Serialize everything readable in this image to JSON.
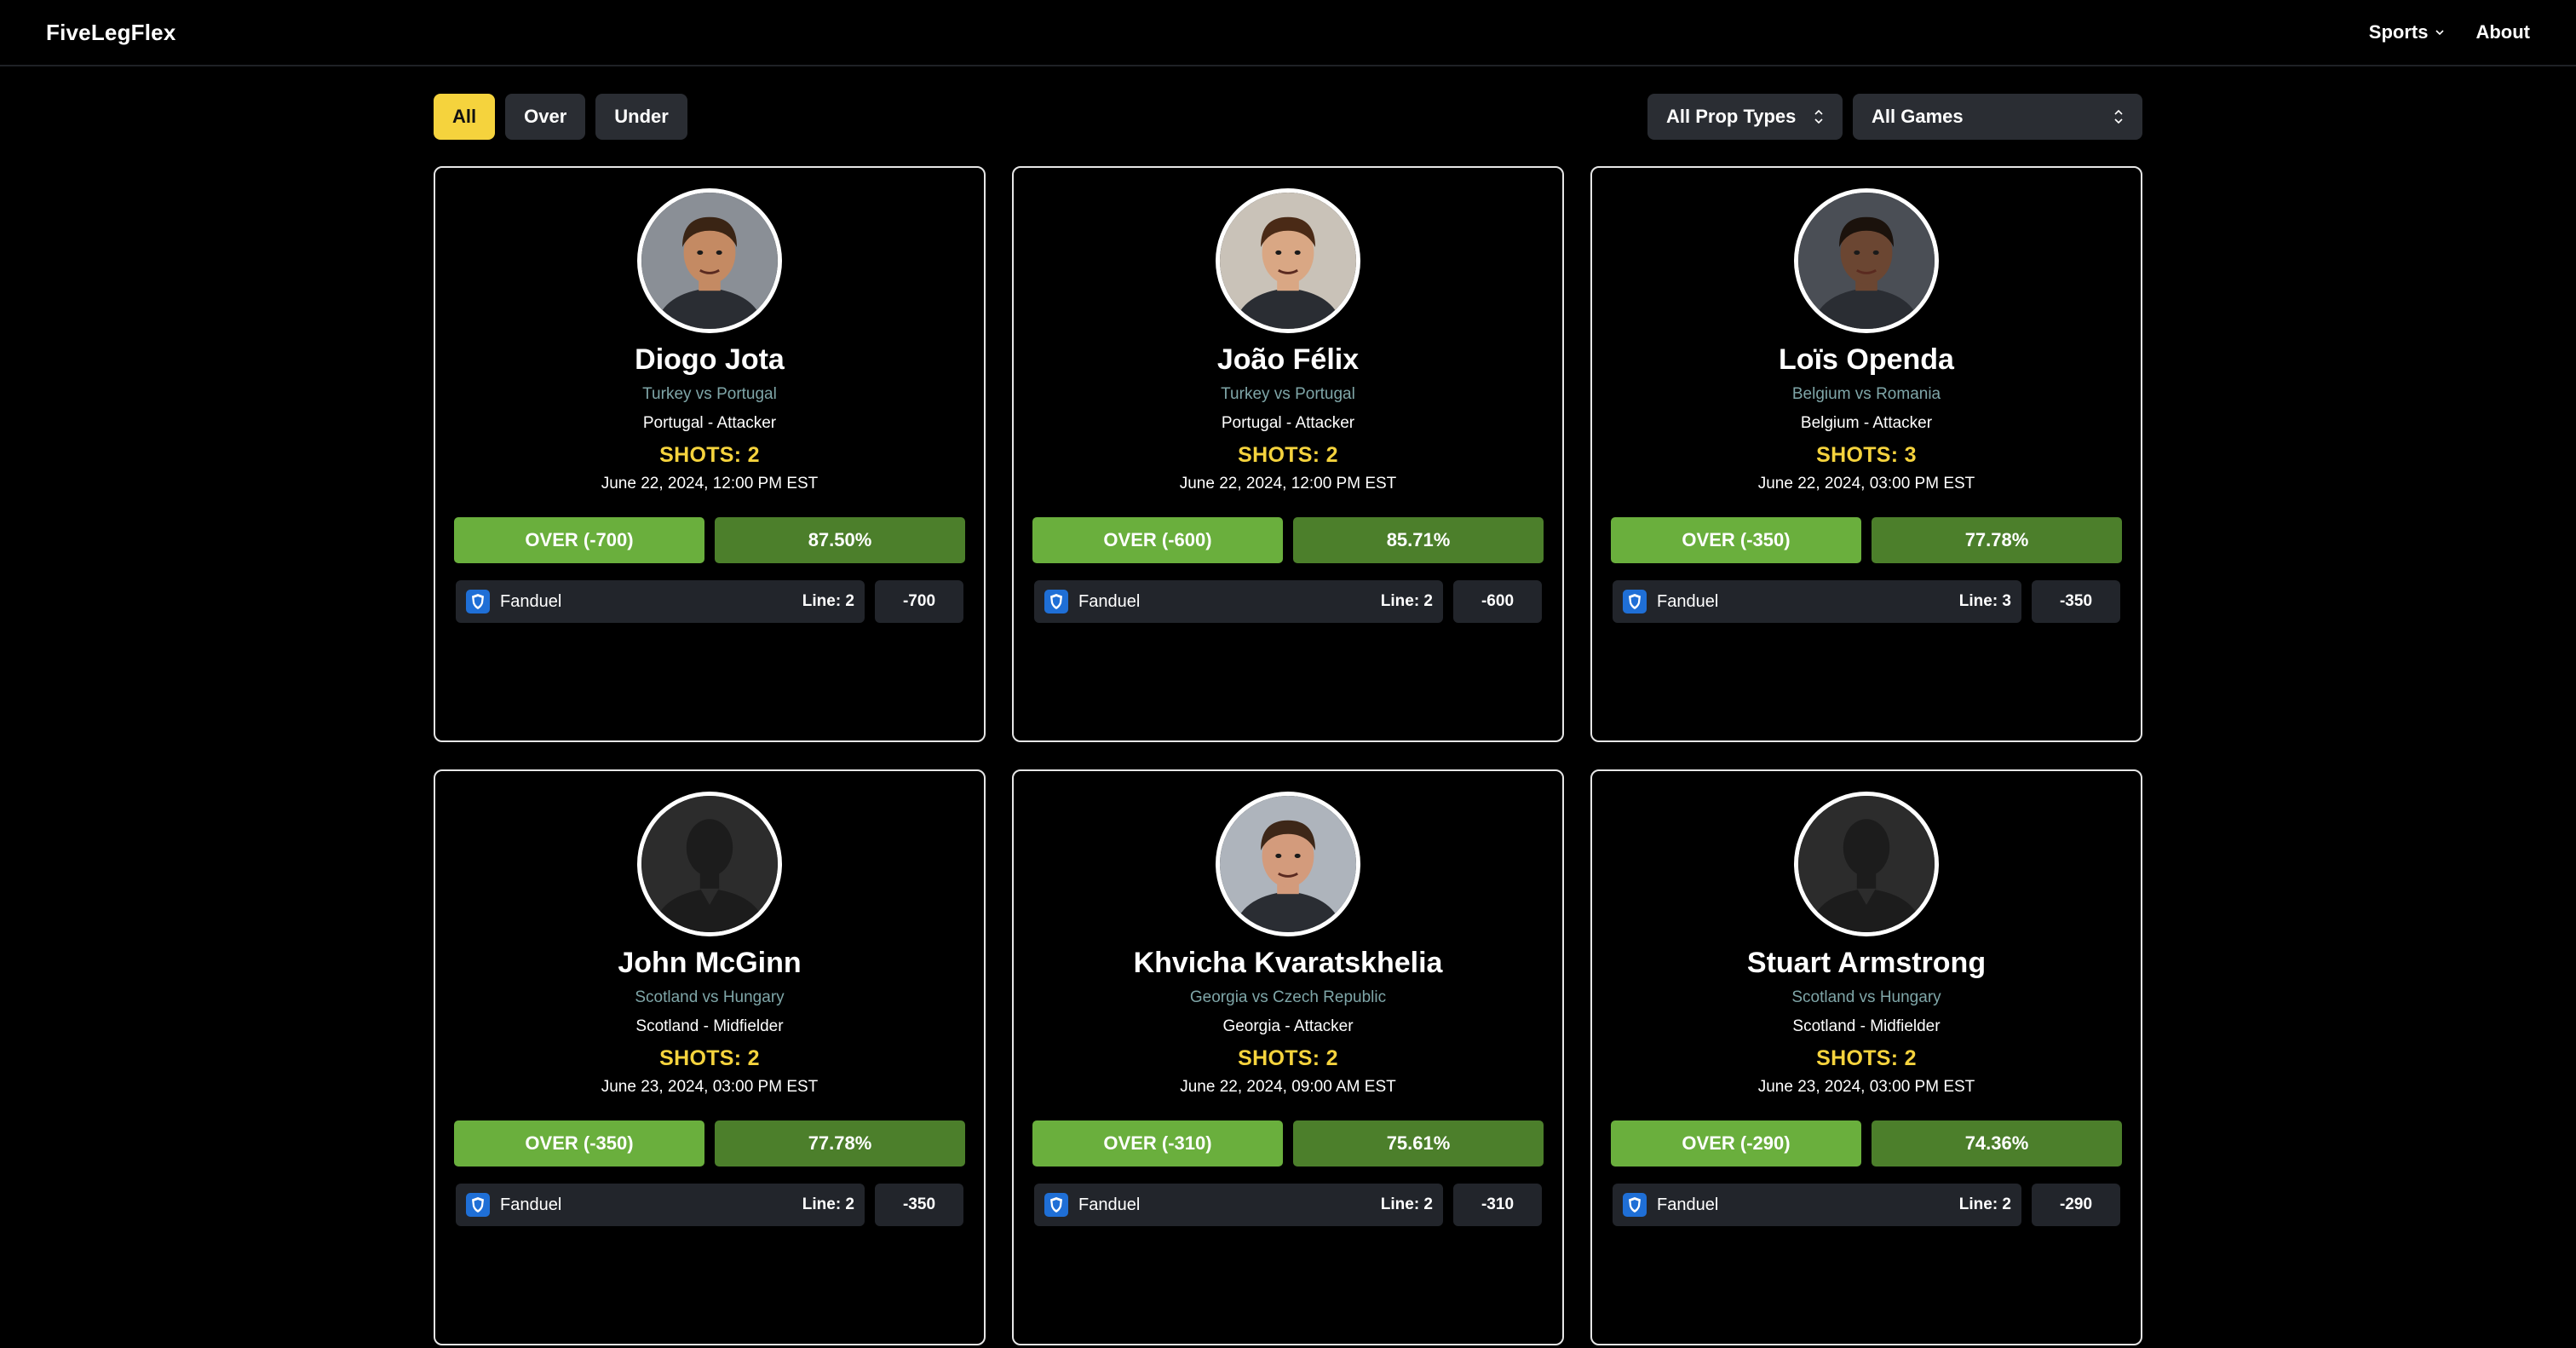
{
  "nav": {
    "brand": "FiveLegFlex",
    "sports_label": "Sports",
    "about_label": "About"
  },
  "filters": {
    "all_label": "All",
    "over_label": "Over",
    "under_label": "Under",
    "active": "All",
    "prop_types": "All Prop Types",
    "games": "All Games"
  },
  "colors": {
    "accent_yellow": "#f5d33d",
    "pick_green": "#6aaf3d",
    "pct_green": "#4c7f2b",
    "matchup_teal": "#7fa6a8"
  },
  "cards": [
    {
      "name": "Diogo Jota",
      "matchup": "Turkey vs Portugal",
      "team_pos": "Portugal - Attacker",
      "prop": "SHOTS: 2",
      "datetime": "June 22, 2024, 12:00 PM EST",
      "pick": "OVER (-700)",
      "pct": "87.50%",
      "book": "Fanduel",
      "line": "Line: 2",
      "odds": "-700",
      "avatar": "photo"
    },
    {
      "name": "João Félix",
      "matchup": "Turkey vs Portugal",
      "team_pos": "Portugal - Attacker",
      "prop": "SHOTS: 2",
      "datetime": "June 22, 2024, 12:00 PM EST",
      "pick": "OVER (-600)",
      "pct": "85.71%",
      "book": "Fanduel",
      "line": "Line: 2",
      "odds": "-600",
      "avatar": "photo"
    },
    {
      "name": "Loïs Openda",
      "matchup": "Belgium vs Romania",
      "team_pos": "Belgium - Attacker",
      "prop": "SHOTS: 3",
      "datetime": "June 22, 2024, 03:00 PM EST",
      "pick": "OVER (-350)",
      "pct": "77.78%",
      "book": "Fanduel",
      "line": "Line: 3",
      "odds": "-350",
      "avatar": "photo"
    },
    {
      "name": "John McGinn",
      "matchup": "Scotland vs Hungary",
      "team_pos": "Scotland - Midfielder",
      "prop": "SHOTS: 2",
      "datetime": "June 23, 2024, 03:00 PM EST",
      "pick": "OVER (-350)",
      "pct": "77.78%",
      "book": "Fanduel",
      "line": "Line: 2",
      "odds": "-350",
      "avatar": "placeholder"
    },
    {
      "name": "Khvicha Kvaratskhelia",
      "matchup": "Georgia vs Czech Republic",
      "team_pos": "Georgia - Attacker",
      "prop": "SHOTS: 2",
      "datetime": "June 22, 2024, 09:00 AM EST",
      "pick": "OVER (-310)",
      "pct": "75.61%",
      "book": "Fanduel",
      "line": "Line: 2",
      "odds": "-310",
      "avatar": "photo"
    },
    {
      "name": "Stuart Armstrong",
      "matchup": "Scotland vs Hungary",
      "team_pos": "Scotland - Midfielder",
      "prop": "SHOTS: 2",
      "datetime": "June 23, 2024, 03:00 PM EST",
      "pick": "OVER (-290)",
      "pct": "74.36%",
      "book": "Fanduel",
      "line": "Line: 2",
      "odds": "-290",
      "avatar": "placeholder"
    }
  ]
}
